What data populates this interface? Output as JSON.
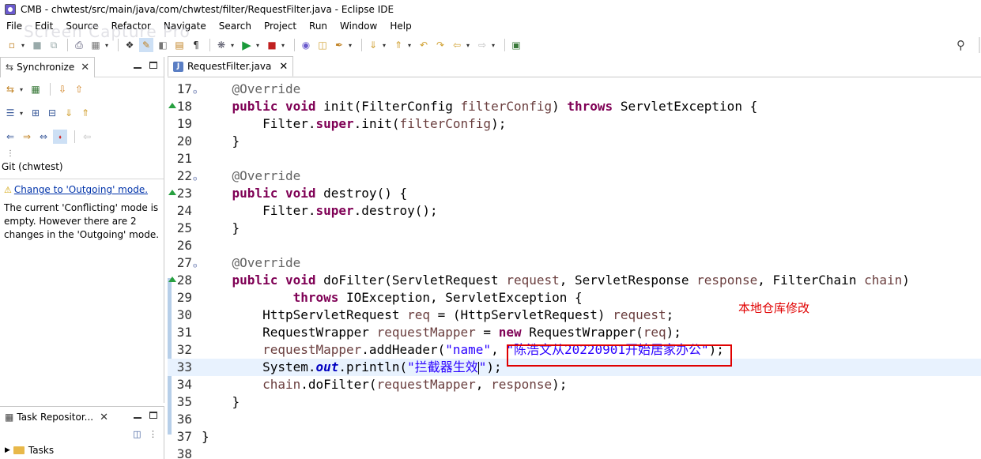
{
  "window": {
    "title": "CMB - chwtest/src/main/java/com/chwtest/filter/RequestFilter.java - Eclipse IDE",
    "watermark": "Screen Capture Pro"
  },
  "menu": [
    "File",
    "Edit",
    "Source",
    "Refactor",
    "Navigate",
    "Search",
    "Project",
    "Run",
    "Window",
    "Help"
  ],
  "toolbar": {
    "icons": [
      "new-icon",
      "save-icon",
      "save-all-icon",
      "print-icon",
      "build-icon",
      "toggle-mark-icon",
      "open-type-icon",
      "open-resource-icon",
      "show-whitespace-icon",
      "debug-icon",
      "run-icon",
      "run-external-icon",
      "open-task-icon",
      "open-folder-icon",
      "annotation-icon",
      "next-annotation-icon",
      "prev-annotation-icon",
      "last-edit-icon",
      "back-icon",
      "forward-icon",
      "open-perspective-icon"
    ],
    "search_icon": "search-icon"
  },
  "left_panel": {
    "tab_label": "Synchronize",
    "context_label": "Git (chwtest)",
    "link_text": "Change to 'Outgoing' mode.",
    "info_lines": [
      "The current 'Conflicting' mode is",
      "empty. However there are 2",
      "changes in the 'Outgoing' mode."
    ]
  },
  "task_panel": {
    "tab_label": "Task Repositor...",
    "tree_item": "Tasks"
  },
  "editor": {
    "tab_label": "RequestFilter.java",
    "current_line": 33,
    "lines": [
      {
        "n": "17",
        "fold": true,
        "override": false,
        "seg": [
          [
            "an",
            "    @Override"
          ]
        ]
      },
      {
        "n": "18",
        "fold": false,
        "override": true,
        "seg": [
          [
            "",
            "    "
          ],
          [
            "kw",
            "public"
          ],
          [
            "",
            " "
          ],
          [
            "kw",
            "void"
          ],
          [
            "",
            " init(FilterConfig "
          ],
          [
            "prm",
            "filterConfig"
          ],
          [
            "",
            ") "
          ],
          [
            "kw",
            "throws"
          ],
          [
            "",
            " ServletException {"
          ]
        ]
      },
      {
        "n": "19",
        "fold": false,
        "override": false,
        "seg": [
          [
            "",
            "        Filter."
          ],
          [
            "kw",
            "super"
          ],
          [
            "",
            ".init("
          ],
          [
            "prm",
            "filterConfig"
          ],
          [
            "",
            ");"
          ]
        ]
      },
      {
        "n": "20",
        "fold": false,
        "override": false,
        "seg": [
          [
            "",
            "    }"
          ]
        ]
      },
      {
        "n": "21",
        "fold": false,
        "override": false,
        "seg": [
          [
            "",
            ""
          ]
        ]
      },
      {
        "n": "22",
        "fold": true,
        "override": false,
        "seg": [
          [
            "an",
            "    @Override"
          ]
        ]
      },
      {
        "n": "23",
        "fold": false,
        "override": true,
        "seg": [
          [
            "",
            "    "
          ],
          [
            "kw",
            "public"
          ],
          [
            "",
            " "
          ],
          [
            "kw",
            "void"
          ],
          [
            "",
            " destroy() {"
          ]
        ]
      },
      {
        "n": "24",
        "fold": false,
        "override": false,
        "seg": [
          [
            "",
            "        Filter."
          ],
          [
            "kw",
            "super"
          ],
          [
            "",
            ".destroy();"
          ]
        ]
      },
      {
        "n": "25",
        "fold": false,
        "override": false,
        "seg": [
          [
            "",
            "    }"
          ]
        ]
      },
      {
        "n": "26",
        "fold": false,
        "override": false,
        "seg": [
          [
            "",
            ""
          ]
        ]
      },
      {
        "n": "27",
        "fold": true,
        "override": false,
        "seg": [
          [
            "an",
            "    @Override"
          ]
        ]
      },
      {
        "n": "28",
        "fold": false,
        "override": true,
        "seg": [
          [
            "",
            "    "
          ],
          [
            "kw",
            "public"
          ],
          [
            "",
            " "
          ],
          [
            "kw",
            "void"
          ],
          [
            "",
            " doFilter(ServletRequest "
          ],
          [
            "prm",
            "request"
          ],
          [
            "",
            ", ServletResponse "
          ],
          [
            "prm",
            "response"
          ],
          [
            "",
            ", FilterChain "
          ],
          [
            "prm",
            "chain"
          ],
          [
            "",
            ")"
          ]
        ]
      },
      {
        "n": "29",
        "fold": false,
        "override": false,
        "seg": [
          [
            "",
            "            "
          ],
          [
            "kw",
            "throws"
          ],
          [
            "",
            " IOException, ServletException {"
          ]
        ]
      },
      {
        "n": "30",
        "fold": false,
        "override": false,
        "seg": [
          [
            "",
            "        HttpServletRequest "
          ],
          [
            "prm",
            "req"
          ],
          [
            "",
            " = (HttpServletRequest) "
          ],
          [
            "prm",
            "request"
          ],
          [
            "",
            ";"
          ]
        ]
      },
      {
        "n": "31",
        "fold": false,
        "override": false,
        "seg": [
          [
            "",
            "        RequestWrapper "
          ],
          [
            "prm",
            "requestMapper"
          ],
          [
            "",
            " = "
          ],
          [
            "kw",
            "new"
          ],
          [
            "",
            " RequestWrapper("
          ],
          [
            "prm",
            "req"
          ],
          [
            "",
            ");"
          ]
        ]
      },
      {
        "n": "32",
        "fold": false,
        "override": false,
        "seg": [
          [
            "",
            "        "
          ],
          [
            "prm",
            "requestMapper"
          ],
          [
            "",
            ".addHeader("
          ],
          [
            "str",
            "\"name\""
          ],
          [
            "",
            ", "
          ],
          [
            "str",
            "\"陈浩文从20220901开始居家办公\""
          ],
          [
            "",
            ");"
          ]
        ]
      },
      {
        "n": "33",
        "fold": false,
        "override": false,
        "seg": [
          [
            "",
            "        System."
          ],
          [
            "fld",
            "out"
          ],
          [
            "",
            ".println("
          ],
          [
            "str",
            "\"拦截器生效"
          ],
          [
            "cursor",
            ""
          ],
          [
            "str",
            "\""
          ],
          [
            "",
            ");"
          ]
        ]
      },
      {
        "n": "34",
        "fold": false,
        "override": false,
        "seg": [
          [
            "",
            "        "
          ],
          [
            "prm",
            "chain"
          ],
          [
            "",
            ".doFilter("
          ],
          [
            "prm",
            "requestMapper"
          ],
          [
            "",
            ", "
          ],
          [
            "prm",
            "response"
          ],
          [
            "",
            ");"
          ]
        ]
      },
      {
        "n": "35",
        "fold": false,
        "override": false,
        "seg": [
          [
            "",
            "    }"
          ]
        ]
      },
      {
        "n": "36",
        "fold": false,
        "override": false,
        "seg": [
          [
            "",
            ""
          ]
        ]
      },
      {
        "n": "37",
        "fold": false,
        "override": false,
        "seg": [
          [
            "",
            "}"
          ]
        ]
      },
      {
        "n": "38",
        "fold": false,
        "override": false,
        "seg": [
          [
            "",
            ""
          ]
        ]
      }
    ]
  },
  "annotation": {
    "text": "本地仓库修改",
    "color": "#e00000"
  },
  "colors": {
    "keyword": "#7f0055",
    "string": "#2a00ff",
    "parameter": "#6a3e3e",
    "annotation": "#646464",
    "field": "#0000c0",
    "current_line": "#e8f2fe"
  }
}
